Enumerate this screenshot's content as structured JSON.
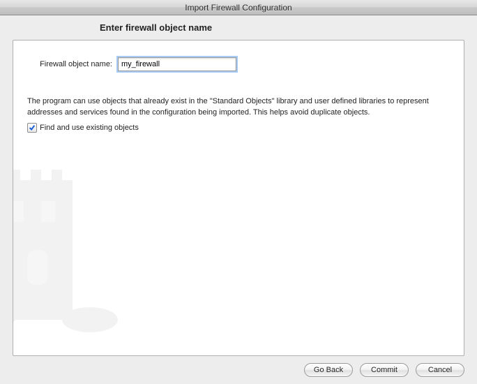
{
  "window": {
    "title": "Import Firewall Configuration"
  },
  "page": {
    "heading": "Enter firewall object name"
  },
  "form": {
    "name_label": "Firewall object name:",
    "name_value": "my_firewall",
    "description": "The program can use objects that already exist in the \"Standard Objects\" library and user defined libraries to represent addresses and services found in the configuration being imported. This helps avoid duplicate objects.",
    "use_existing_label": "Find and use existing objects",
    "use_existing_checked": true
  },
  "buttons": {
    "go_back": "Go Back",
    "commit": "Commit",
    "cancel": "Cancel"
  }
}
